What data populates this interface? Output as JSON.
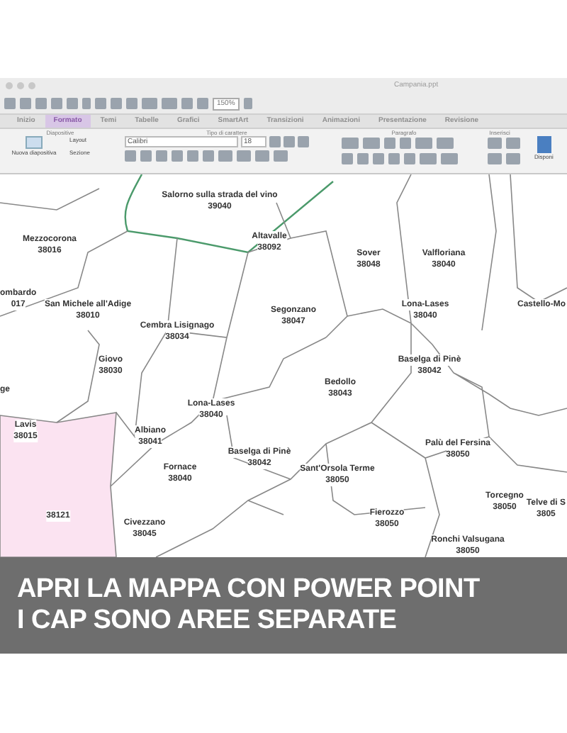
{
  "window": {
    "title": "Campania.ppt"
  },
  "toolbar": {
    "zoom": "150%"
  },
  "tabs": [
    {
      "label": "Inizio",
      "selected": false
    },
    {
      "label": "Formato",
      "selected": true
    },
    {
      "label": "Temi",
      "selected": false
    },
    {
      "label": "Tabelle",
      "selected": false
    },
    {
      "label": "Grafici",
      "selected": false
    },
    {
      "label": "SmartArt",
      "selected": false
    },
    {
      "label": "Transizioni",
      "selected": false
    },
    {
      "label": "Animazioni",
      "selected": false
    },
    {
      "label": "Presentazione",
      "selected": false
    },
    {
      "label": "Revisione",
      "selected": false
    }
  ],
  "ribbon": {
    "groups": [
      "Diapositive",
      "Tipo di carattere",
      "Paragrafo",
      "Inserisci"
    ],
    "new_slide": "Nuova diapositiva",
    "layout": "Layout",
    "section": "Sezione",
    "font": "Calibri",
    "size": "18",
    "arrange": "Disponi"
  },
  "map": {
    "regions": [
      {
        "name": "Salorno sulla strada del vino",
        "cap": "39040"
      },
      {
        "name": "Mezzocorona",
        "cap": "38016"
      },
      {
        "name": "Altavalle",
        "cap": "38092"
      },
      {
        "name": "Sover",
        "cap": "38048"
      },
      {
        "name": "Valfloriana",
        "cap": "38040"
      },
      {
        "name": "ombardo",
        "cap": "017"
      },
      {
        "name": "San Michele all'Adige",
        "cap": "38010"
      },
      {
        "name": "Cembra Lisignago",
        "cap": "38034"
      },
      {
        "name": "Segonzano",
        "cap": "38047"
      },
      {
        "name": "Lona-Lases",
        "cap": "38040"
      },
      {
        "name": "Castello-Mo"
      },
      {
        "name": "Giovo",
        "cap": "38030"
      },
      {
        "name": "Baselga di Pinè",
        "cap": "38042"
      },
      {
        "name": "ge"
      },
      {
        "name": "Bedollo",
        "cap": "38043"
      },
      {
        "name": "Lona-Lases",
        "cap": "38040"
      },
      {
        "name": "Lavis",
        "cap": "38015"
      },
      {
        "name": "Albiano",
        "cap": "38041"
      },
      {
        "name": "Palù del Fersina",
        "cap": "38050"
      },
      {
        "name": "Baselga di Pinè",
        "cap": "38042"
      },
      {
        "name": "Fornace",
        "cap": "38040"
      },
      {
        "name": "Sant'Orsola Terme",
        "cap": "38050"
      },
      {
        "cap": "38121"
      },
      {
        "name": "Torcegno",
        "cap": "38050"
      },
      {
        "name": "Telve di S",
        "cap": "3805"
      },
      {
        "name": "Civezzano",
        "cap": "38045"
      },
      {
        "name": "Fierozzo",
        "cap": "38050"
      },
      {
        "name": "Ronchi Valsugana",
        "cap": "38050"
      }
    ]
  },
  "banner": {
    "lines": [
      "APRI LA MAPPA CON POWER POINT",
      "I CAP SONO AREE SEPARATE"
    ]
  }
}
